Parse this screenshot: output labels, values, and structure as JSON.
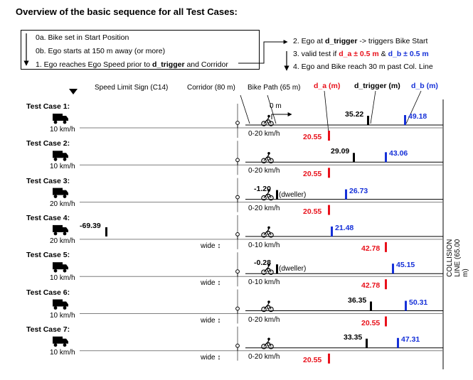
{
  "title": "Overview of the basic sequence for all Test Cases:",
  "legend": {
    "left": [
      "0a. Bike set in Start Position",
      "0b. Ego starts at 150 m away (or more)",
      "1. Ego reaches Ego Speed prior to ",
      "d_trigger",
      " and Corridor"
    ],
    "right": {
      "l2_pre": "2. Ego at ",
      "l2_bold": "d_trigger",
      "l2_post": " -> triggers Bike Start",
      "l3_pre": "3. valid test if ",
      "l3_red": "d_a ± 0.5 m",
      "l3_mid": " & ",
      "l3_blue": "d_b ± 0.5 m",
      "l4": "4. Ego and Bike reach 30 m past Col. Line"
    }
  },
  "headers": {
    "speed_sign": "Speed Limit Sign (C14)",
    "corridor": "Corridor (80 m)",
    "bike_path": "Bike Path (65 m)",
    "d_a": "d_a (m)",
    "d_trigger": "d_trigger (m)",
    "d_b": "d_b (m)",
    "zero": "0 m",
    "collision": "COLLISION LINE (65.00 m)"
  },
  "colors": {
    "red": "#e8101a",
    "blue": "#1530d8",
    "black": "#000000",
    "grey": "#7f7f7f"
  },
  "cases": [
    {
      "name": "Test Case 1:",
      "speed": "10 km/h",
      "bike": "0-20 km/h",
      "d_a": "20.55",
      "d_trigger": "35.22",
      "d_b": "49.18",
      "dweller": "",
      "wide": ""
    },
    {
      "name": "Test Case 2:",
      "speed": "10 km/h",
      "bike": "0-20 km/h",
      "d_a": "20.55",
      "d_trigger": "29.09",
      "d_b": "43.06",
      "dweller": "",
      "wide": ""
    },
    {
      "name": "Test Case 3:",
      "speed": "20 km/h",
      "bike": "0-20 km/h",
      "d_a": "20.55",
      "d_trigger": "-1.20",
      "d_b": "26.73",
      "dweller": "(dweller)",
      "wide": ""
    },
    {
      "name": "Test Case 4:",
      "speed": "20 km/h",
      "bike": "0-10 km/h",
      "d_a": "42.78",
      "d_trigger": "-69.39",
      "d_b": "21.48",
      "dweller": "",
      "wide": "wide ↕"
    },
    {
      "name": "Test Case 5:",
      "speed": "10 km/h",
      "bike": "0-10 km/h",
      "d_a": "42.78",
      "d_trigger": "-0.28",
      "d_b": "45.15",
      "dweller": "(dweller)",
      "wide": "wide ↕"
    },
    {
      "name": "Test Case 6:",
      "speed": "10 km/h",
      "bike": "0-20 km/h",
      "d_a": "20.55",
      "d_trigger": "36.35",
      "d_b": "50.31",
      "dweller": "",
      "wide": "wide ↕"
    },
    {
      "name": "Test Case 7:",
      "speed": "10 km/h",
      "bike": "0-20 km/h",
      "d_a": "20.55",
      "d_trigger": "33.35",
      "d_b": "47.31",
      "dweller": "",
      "wide": "wide ↕"
    }
  ]
}
